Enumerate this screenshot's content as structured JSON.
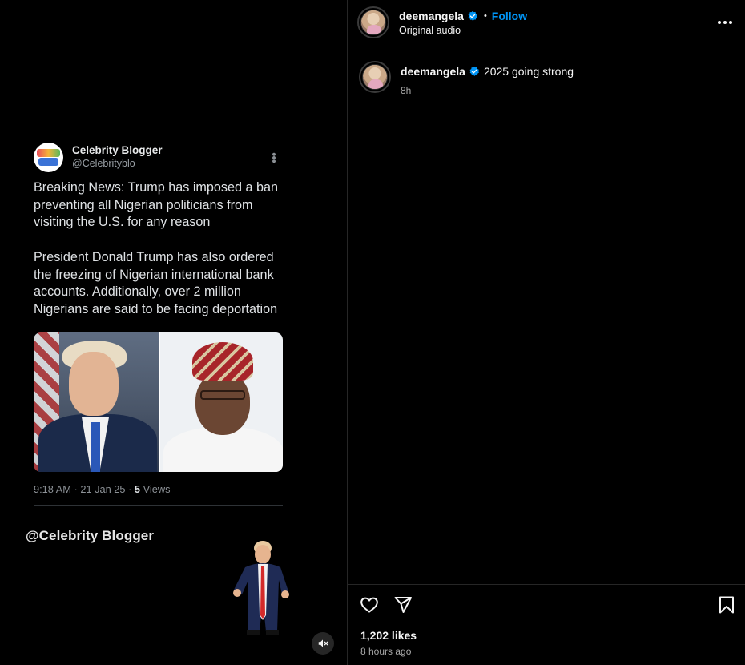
{
  "post": {
    "username": "deemangela",
    "follow_label": "Follow",
    "separator": "•",
    "audio_label": "Original audio",
    "caption_username": "deemangela",
    "caption_text": "2025 going strong",
    "caption_time": "8h",
    "likes": "1,202 likes",
    "posted_ago": "8 hours ago"
  },
  "video": {
    "tweet": {
      "author": "Celebrity Blogger",
      "handle": "@Celebrityblo",
      "paragraph1": "Breaking News: Trump has imposed a ban preventing all Nigerian politicians from visiting the U.S. for any reason",
      "paragraph2": "President Donald Trump has also ordered the freezing of Nigerian international bank accounts. Additionally, over 2 million Nigerians are said to be facing deportation",
      "time_date": "9:18 AM · 21 Jan 25 · ",
      "views_count": "5",
      "views_label": " Views"
    },
    "credit": "@Celebrity Blogger"
  },
  "icons": {
    "verified": "verified-badge-icon",
    "more": "more-options-icon",
    "like": "heart-icon",
    "share": "send-icon",
    "save": "bookmark-icon",
    "mute": "muted-speaker-icon"
  },
  "colors": {
    "background": "#000000",
    "follow_blue": "#0095f6",
    "verified_blue": "#0095f6",
    "secondary_text": "#a8a8a8",
    "divider": "#262626"
  }
}
